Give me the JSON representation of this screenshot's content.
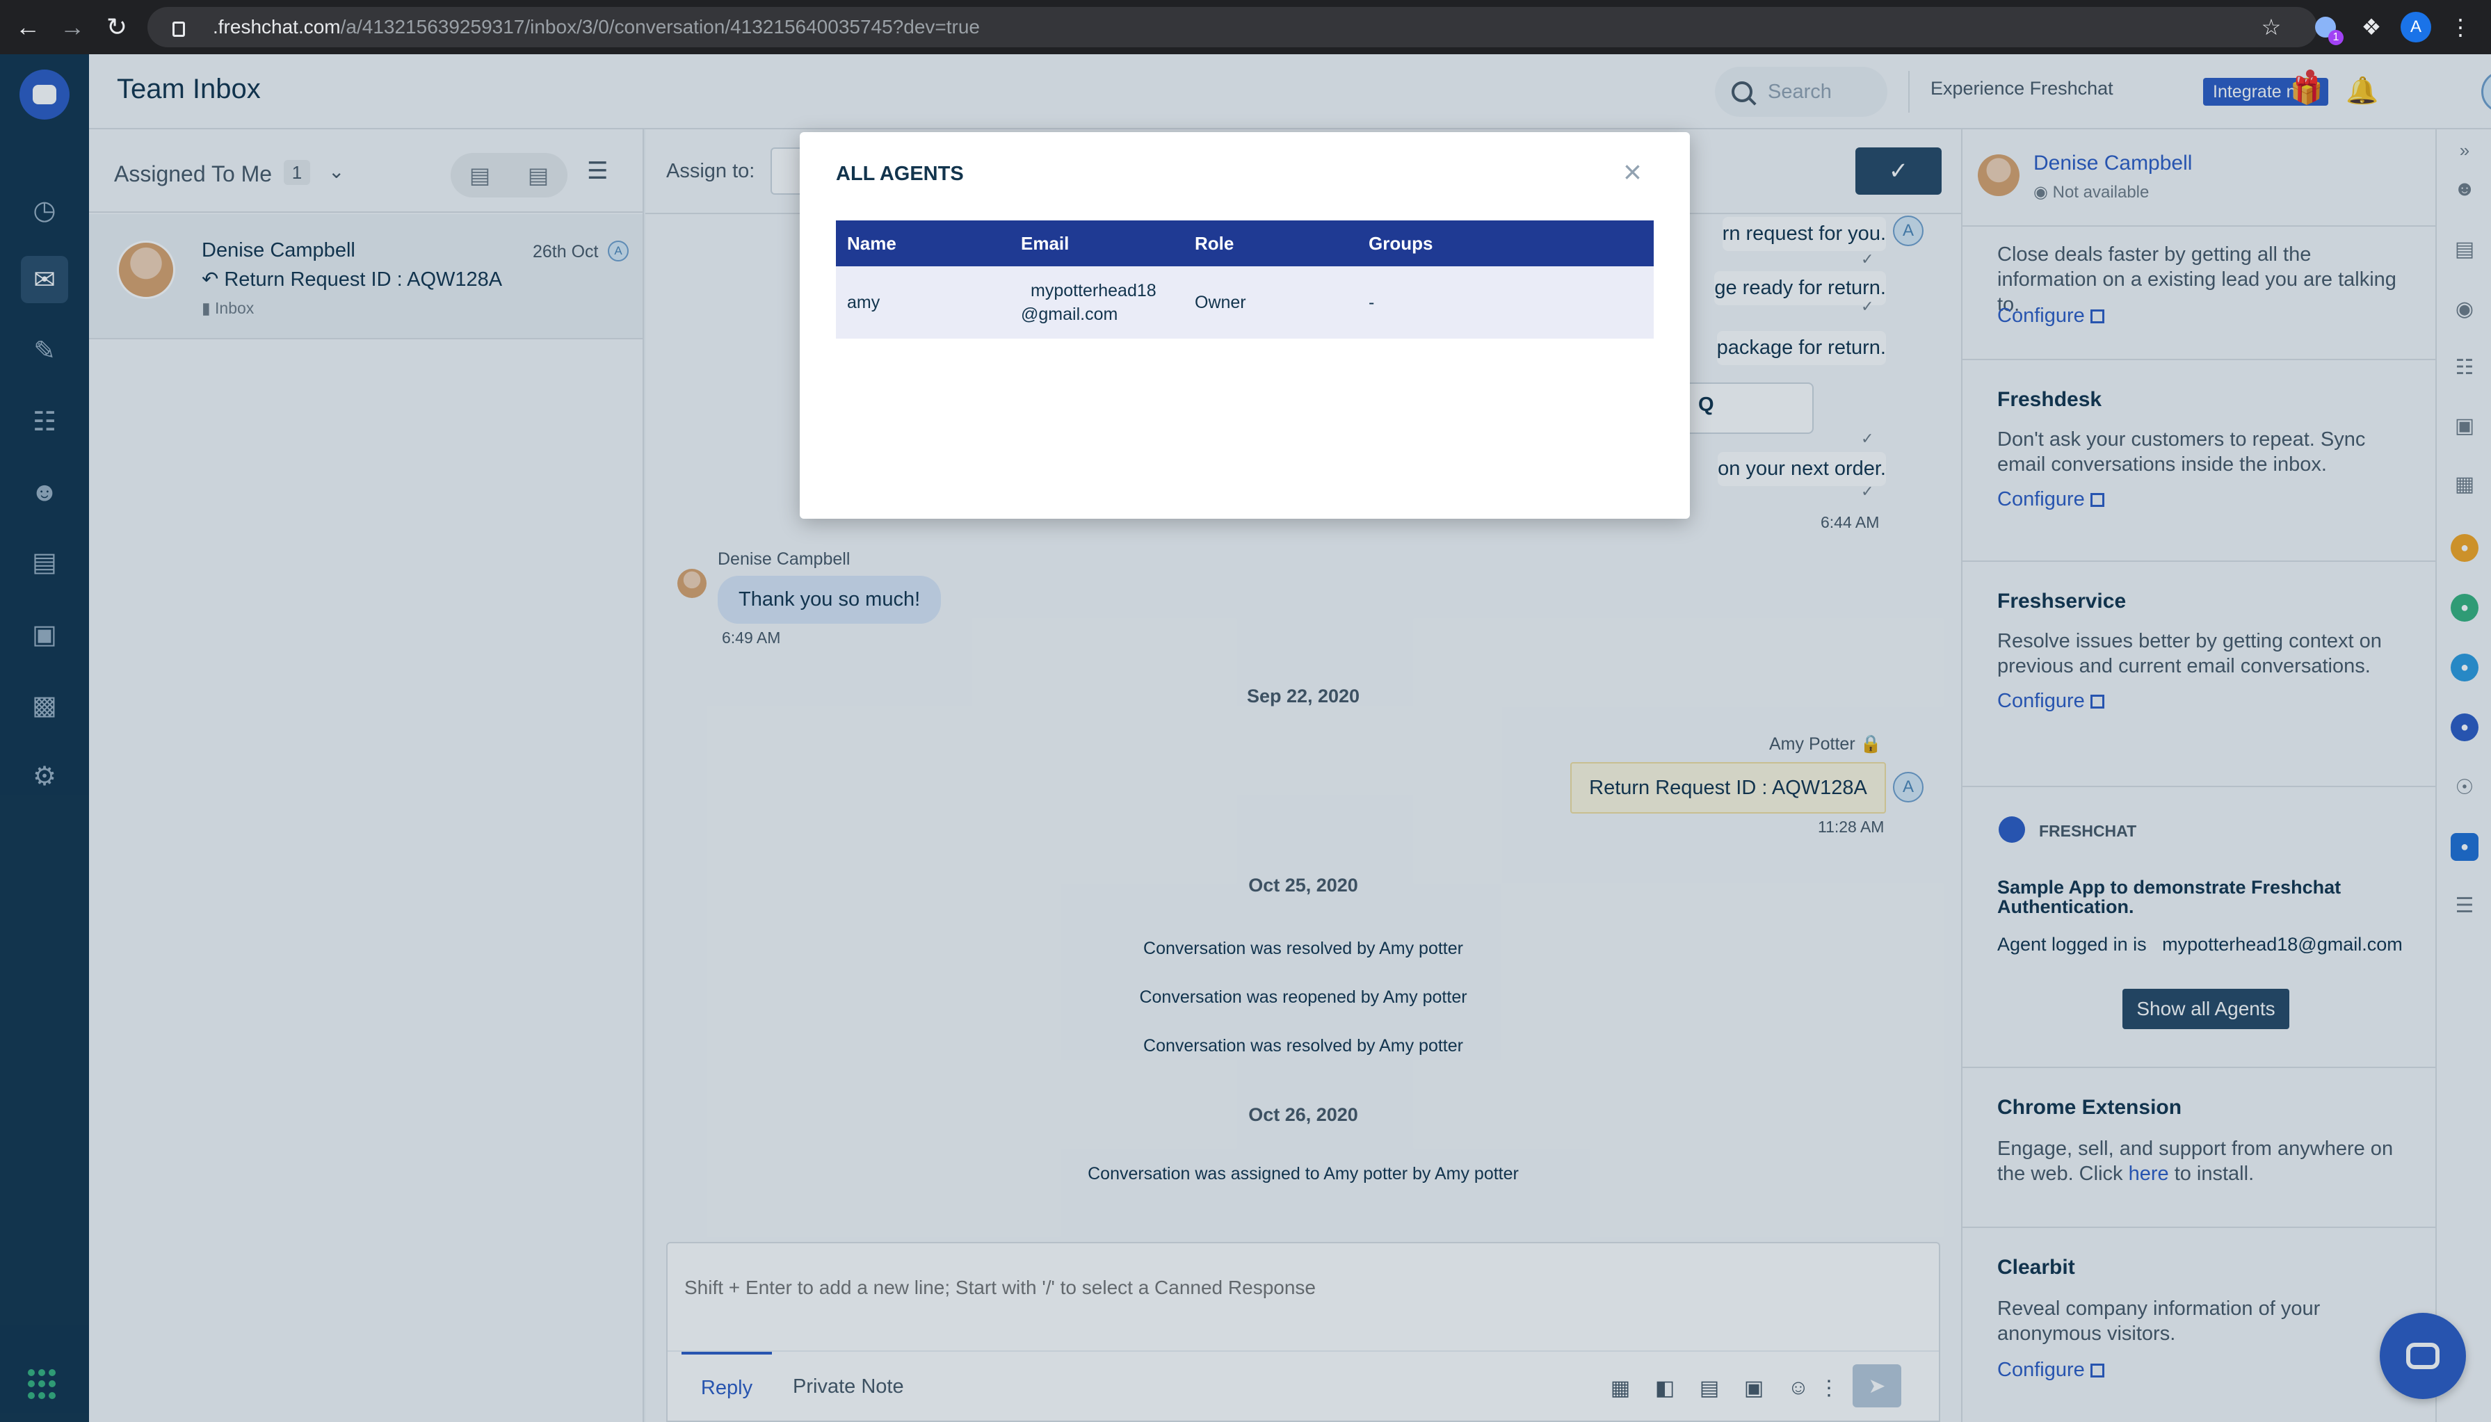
{
  "browser": {
    "url_host": ".freshchat.com",
    "url_path": "/a/413215639259317/inbox/3/0/conversation/413215640035745?dev=true",
    "profile_initial": "A",
    "extension_badge": "1"
  },
  "header": {
    "title": "Team Inbox",
    "search_placeholder": "Search",
    "experience_text": "Experience Freshchat",
    "integrate_label": "Integrate now",
    "avatar_initial": "A"
  },
  "conversation_list": {
    "filter_label": "Assigned To Me",
    "filter_count": "1",
    "items": [
      {
        "name": "Denise Campbell",
        "date": "26th Oct",
        "agent_initial": "A",
        "subject": "Return Request ID : AQW128A",
        "inbox": "Inbox"
      }
    ]
  },
  "chat": {
    "assign_label": "Assign to:",
    "outgoing_fragments": [
      "rn request for you.",
      "ge ready for return.",
      "package for return.",
      "Q",
      "on your next order."
    ],
    "first_block_time": "6:44 AM",
    "agent_initial": "A",
    "incoming": {
      "sender": "Denise Campbell",
      "text": "Thank you so much!",
      "time": "6:49 AM"
    },
    "date_1": "Sep 22, 2020",
    "outgoing_2": {
      "sender": "Amy Potter",
      "text": "Return Request ID : AQW128A",
      "time": "11:28 AM"
    },
    "date_2": "Oct 25, 2020",
    "system_1": "Conversation was resolved by Amy potter",
    "system_2": "Conversation was reopened by Amy potter",
    "system_3": "Conversation was resolved by Amy potter",
    "date_3": "Oct 26, 2020",
    "system_4": "Conversation was assigned to Amy potter by Amy potter",
    "composer_placeholder": "Shift + Enter to add a new line; Start with '/' to select a Canned Response",
    "tab_reply": "Reply",
    "tab_private_note": "Private Note"
  },
  "right_panel": {
    "contact_name": "Denise Campbell",
    "contact_status": "Not available",
    "intro_text": "Close deals faster by getting all the information on a existing lead you are talking to.",
    "configure_label": "Configure",
    "freshdesk_title": "Freshdesk",
    "freshdesk_text": "Don't ask your customers to repeat. Sync email conversations inside the inbox.",
    "freshservice_title": "Freshservice",
    "freshservice_text": "Resolve issues better by getting context on previous and current email conversations.",
    "freshchat_label": "FRESHCHAT",
    "sample_app_title": "Sample App to demonstrate Freshchat Authentication.",
    "agent_logged_label": "Agent logged in is",
    "agent_logged_email": "mypotterhead18@gmail.com",
    "show_agents_label": "Show all Agents",
    "chrome_ext_title": "Chrome Extension",
    "chrome_ext_text_before": "Engage, sell, and support from anywhere on the web. Click",
    "chrome_ext_link": "here",
    "chrome_ext_text_after": "to install.",
    "clearbit_title": "Clearbit",
    "clearbit_text": "Reveal company information of your anonymous visitors."
  },
  "modal": {
    "title": "ALL AGENTS",
    "columns": [
      "Name",
      "Email",
      "Role",
      "Groups"
    ],
    "rows": [
      {
        "name": "amy",
        "email_line1": "mypotterhead18",
        "email_line2": "@gmail.com",
        "role": "Owner",
        "groups": "-"
      }
    ]
  },
  "colors": {
    "nav_bg": "#12344d",
    "accent": "#2c5cc5",
    "table_header": "#1f3a93",
    "table_row": "#eaecf7",
    "agent_bubble": "#fdf7e0",
    "customer_bubble": "#d9e6f7"
  }
}
